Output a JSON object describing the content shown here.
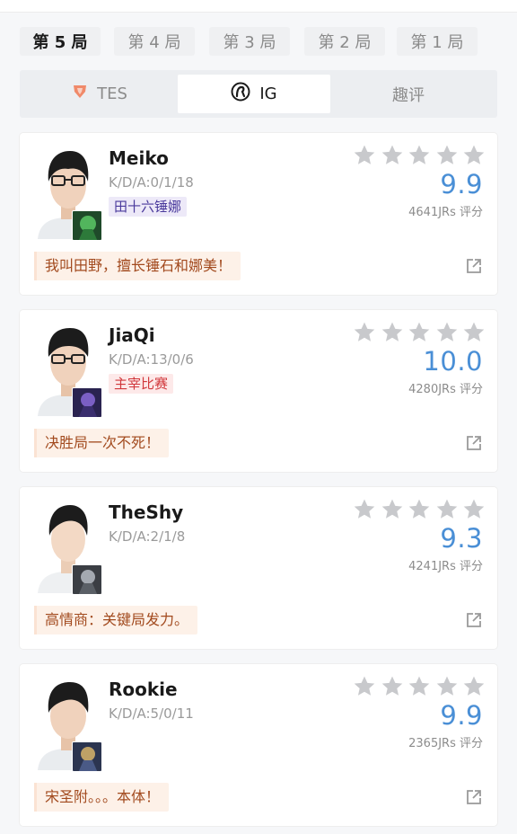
{
  "game_tabs": [
    {
      "label": "第 5 局",
      "active": true
    },
    {
      "label": "第 4 局",
      "active": false
    },
    {
      "label": "第 3 局",
      "active": false
    },
    {
      "label": "第 2 局",
      "active": false
    },
    {
      "label": "第 1 局",
      "active": false
    }
  ],
  "team_tabs": [
    {
      "label": "TES",
      "icon": "tes-logo-icon",
      "active": false
    },
    {
      "label": "IG",
      "icon": "ig-logo-icon",
      "active": true
    },
    {
      "label": "趣评",
      "active": false
    }
  ],
  "players": [
    {
      "name": "Meiko",
      "kda": "K/D/A:0/1/18",
      "tag": "田十六锤娜",
      "tag_style": "purple",
      "score": "9.9",
      "count": "4641JRs 评分",
      "comment": "我叫田野，擅长锤石和娜美！",
      "champion_icon": "thresh-champion-icon",
      "stars_filled": 0,
      "stars_total": 5
    },
    {
      "name": "JiaQi",
      "kda": "K/D/A:13/0/6",
      "tag": "主宰比赛",
      "tag_style": "red",
      "score": "10.0",
      "count": "4280JRs 评分",
      "comment": "决胜局一次不死！",
      "champion_icon": "kaisa-champion-icon",
      "stars_filled": 0,
      "stars_total": 5
    },
    {
      "name": "TheShy",
      "kda": "K/D/A:2/1/8",
      "tag": "",
      "tag_style": "",
      "score": "9.3",
      "count": "4241JRs 评分",
      "comment": "高情商：关键局发力。",
      "champion_icon": "champion-icon",
      "stars_filled": 0,
      "stars_total": 5
    },
    {
      "name": "Rookie",
      "kda": "K/D/A:5/0/11",
      "tag": "",
      "tag_style": "",
      "score": "9.9",
      "count": "2365JRs 评分",
      "comment": "宋圣附。。。本体！",
      "champion_icon": "champion-icon",
      "stars_filled": 0,
      "stars_total": 5
    }
  ],
  "colors": {
    "score_blue": "#4a8fd6",
    "star_gray": "#c8c9cc",
    "comment_bg": "#fdf1e8",
    "comment_text": "#a24a1e"
  }
}
